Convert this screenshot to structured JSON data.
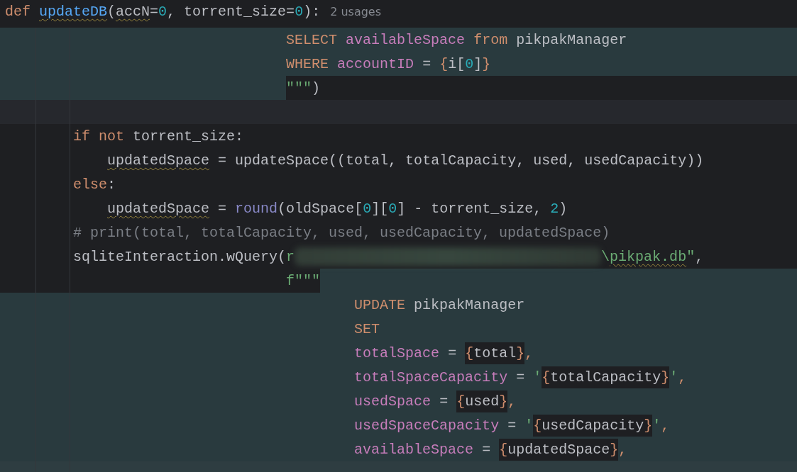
{
  "editor": {
    "lines": [
      {
        "kind": "plain",
        "tokens": [
          {
            "text": "def ",
            "kind": "keyword"
          },
          {
            "text": "updateDB",
            "kind": "function",
            "warning": true
          },
          {
            "text": "(",
            "kind": "plain"
          },
          {
            "text": "accN",
            "kind": "plain",
            "warning": true
          },
          {
            "text": "=",
            "kind": "plain"
          },
          {
            "text": "0",
            "kind": "number"
          },
          {
            "text": ", torrent_size=",
            "kind": "plain"
          },
          {
            "text": "0",
            "kind": "number"
          },
          {
            "text": "):",
            "kind": "plain"
          },
          {
            "text": "2 usages",
            "kind": "hint"
          }
        ]
      },
      {
        "kind": "injected",
        "tokens": [
          {
            "text": "                                 SELECT ",
            "kind": "keyword"
          },
          {
            "text": "availableSpace ",
            "kind": "column"
          },
          {
            "text": "from ",
            "kind": "keyword"
          },
          {
            "text": "pikpakManager",
            "kind": "plain"
          }
        ]
      },
      {
        "kind": "injected",
        "tokens": [
          {
            "text": "                                 WHERE ",
            "kind": "keyword"
          },
          {
            "text": "accountID",
            "kind": "column"
          },
          {
            "text": " = ",
            "kind": "plain"
          },
          {
            "text": "{",
            "kind": "punct"
          },
          {
            "text": "i[",
            "kind": "plain"
          },
          {
            "text": "0",
            "kind": "number"
          },
          {
            "text": "]",
            "kind": "plain"
          },
          {
            "text": "}",
            "kind": "punct"
          }
        ]
      },
      {
        "kind": "injected_lead",
        "tokens": [
          {
            "text": "                                 \"\"\"",
            "kind": "string"
          },
          {
            "text": ")",
            "kind": "plain"
          }
        ]
      },
      {
        "kind": "current"
      },
      {
        "kind": "plain",
        "tokens": [
          {
            "text": "        if not ",
            "kind": "keyword"
          },
          {
            "text": "torrent_size:",
            "kind": "plain"
          }
        ]
      },
      {
        "kind": "plain",
        "tokens": [
          {
            "text": "            updatedSpace",
            "kind": "plain",
            "warning": true
          },
          {
            "text": " = updateSpace((total, totalCapacity, used, usedCapacity))",
            "kind": "plain"
          }
        ]
      },
      {
        "kind": "plain",
        "tokens": [
          {
            "text": "        else",
            "kind": "keyword"
          },
          {
            "text": ":",
            "kind": "plain"
          }
        ]
      },
      {
        "kind": "plain",
        "tokens": [
          {
            "text": "            updatedSpace",
            "kind": "plain",
            "warning": true
          },
          {
            "text": " = ",
            "kind": "plain"
          },
          {
            "text": "round",
            "kind": "builtin"
          },
          {
            "text": "(oldSpace[",
            "kind": "plain"
          },
          {
            "text": "0",
            "kind": "number"
          },
          {
            "text": "][",
            "kind": "plain"
          },
          {
            "text": "0",
            "kind": "number"
          },
          {
            "text": "] - torrent_size, ",
            "kind": "plain"
          },
          {
            "text": "2",
            "kind": "number"
          },
          {
            "text": ")",
            "kind": "plain"
          }
        ]
      },
      {
        "kind": "plain",
        "tokens": [
          {
            "text": "        # print(total, totalCapacity, used, usedCapacity, updatedSpace)",
            "kind": "comment"
          }
        ]
      },
      {
        "kind": "plain",
        "tokens": [
          {
            "text": "        sqliteInteraction.wQuery(",
            "kind": "plain"
          },
          {
            "text": "r",
            "kind": "string"
          },
          {
            "kind": "redacted"
          },
          {
            "text": "\\",
            "kind": "string"
          },
          {
            "text": "pikpak.db",
            "kind": "string",
            "warning": true
          },
          {
            "text": "\"",
            "kind": "string"
          },
          {
            "text": ",",
            "kind": "plain"
          }
        ]
      },
      {
        "kind": "injected_tail",
        "tokens": [
          {
            "text": "                                 f\"\"\"",
            "kind": "string"
          }
        ]
      },
      {
        "kind": "injected",
        "tokens": [
          {
            "text": "                                         UPDATE ",
            "kind": "keyword"
          },
          {
            "text": "pikpakManager",
            "kind": "plain"
          }
        ]
      },
      {
        "kind": "injected",
        "tokens": [
          {
            "text": "                                         SET",
            "kind": "keyword"
          }
        ]
      },
      {
        "kind": "injected",
        "tokens": [
          {
            "text": "                                         totalSpace",
            "kind": "column"
          },
          {
            "text": " = ",
            "kind": "plain"
          },
          {
            "text": "{",
            "kind": "punct",
            "boxed": true
          },
          {
            "text": "total",
            "kind": "plain",
            "boxed": true
          },
          {
            "text": "}",
            "kind": "punct",
            "boxed": true
          },
          {
            "text": ",",
            "kind": "punct"
          }
        ]
      },
      {
        "kind": "injected",
        "tokens": [
          {
            "text": "                                         totalSpaceCapacity",
            "kind": "column"
          },
          {
            "text": " = ",
            "kind": "plain"
          },
          {
            "text": "'",
            "kind": "string"
          },
          {
            "text": "{",
            "kind": "punct",
            "boxed": true
          },
          {
            "text": "totalCapacity",
            "kind": "plain",
            "boxed": true
          },
          {
            "text": "}",
            "kind": "punct",
            "boxed": true
          },
          {
            "text": "'",
            "kind": "string"
          },
          {
            "text": ",",
            "kind": "punct"
          }
        ]
      },
      {
        "kind": "injected",
        "tokens": [
          {
            "text": "                                         usedSpace",
            "kind": "column"
          },
          {
            "text": " = ",
            "kind": "plain"
          },
          {
            "text": "{",
            "kind": "punct",
            "boxed": true
          },
          {
            "text": "used",
            "kind": "plain",
            "boxed": true
          },
          {
            "text": "}",
            "kind": "punct",
            "boxed": true
          },
          {
            "text": ",",
            "kind": "punct"
          }
        ]
      },
      {
        "kind": "injected",
        "tokens": [
          {
            "text": "                                         usedSpaceCapacity",
            "kind": "column"
          },
          {
            "text": " = ",
            "kind": "plain"
          },
          {
            "text": "'",
            "kind": "string"
          },
          {
            "text": "{",
            "kind": "punct",
            "boxed": true
          },
          {
            "text": "usedCapacity",
            "kind": "plain",
            "boxed": true
          },
          {
            "text": "}",
            "kind": "punct",
            "boxed": true
          },
          {
            "text": "'",
            "kind": "string"
          },
          {
            "text": ",",
            "kind": "punct"
          }
        ]
      },
      {
        "kind": "injected",
        "tokens": [
          {
            "text": "                                         availableSpace",
            "kind": "column"
          },
          {
            "text": " = ",
            "kind": "plain"
          },
          {
            "text": "{",
            "kind": "punct",
            "boxed": true
          },
          {
            "text": "updatedSpace",
            "kind": "plain",
            "boxed": true
          },
          {
            "text": "}",
            "kind": "punct",
            "boxed": true
          },
          {
            "text": ",",
            "kind": "punct"
          }
        ]
      },
      {
        "kind": "current_injected"
      }
    ]
  }
}
